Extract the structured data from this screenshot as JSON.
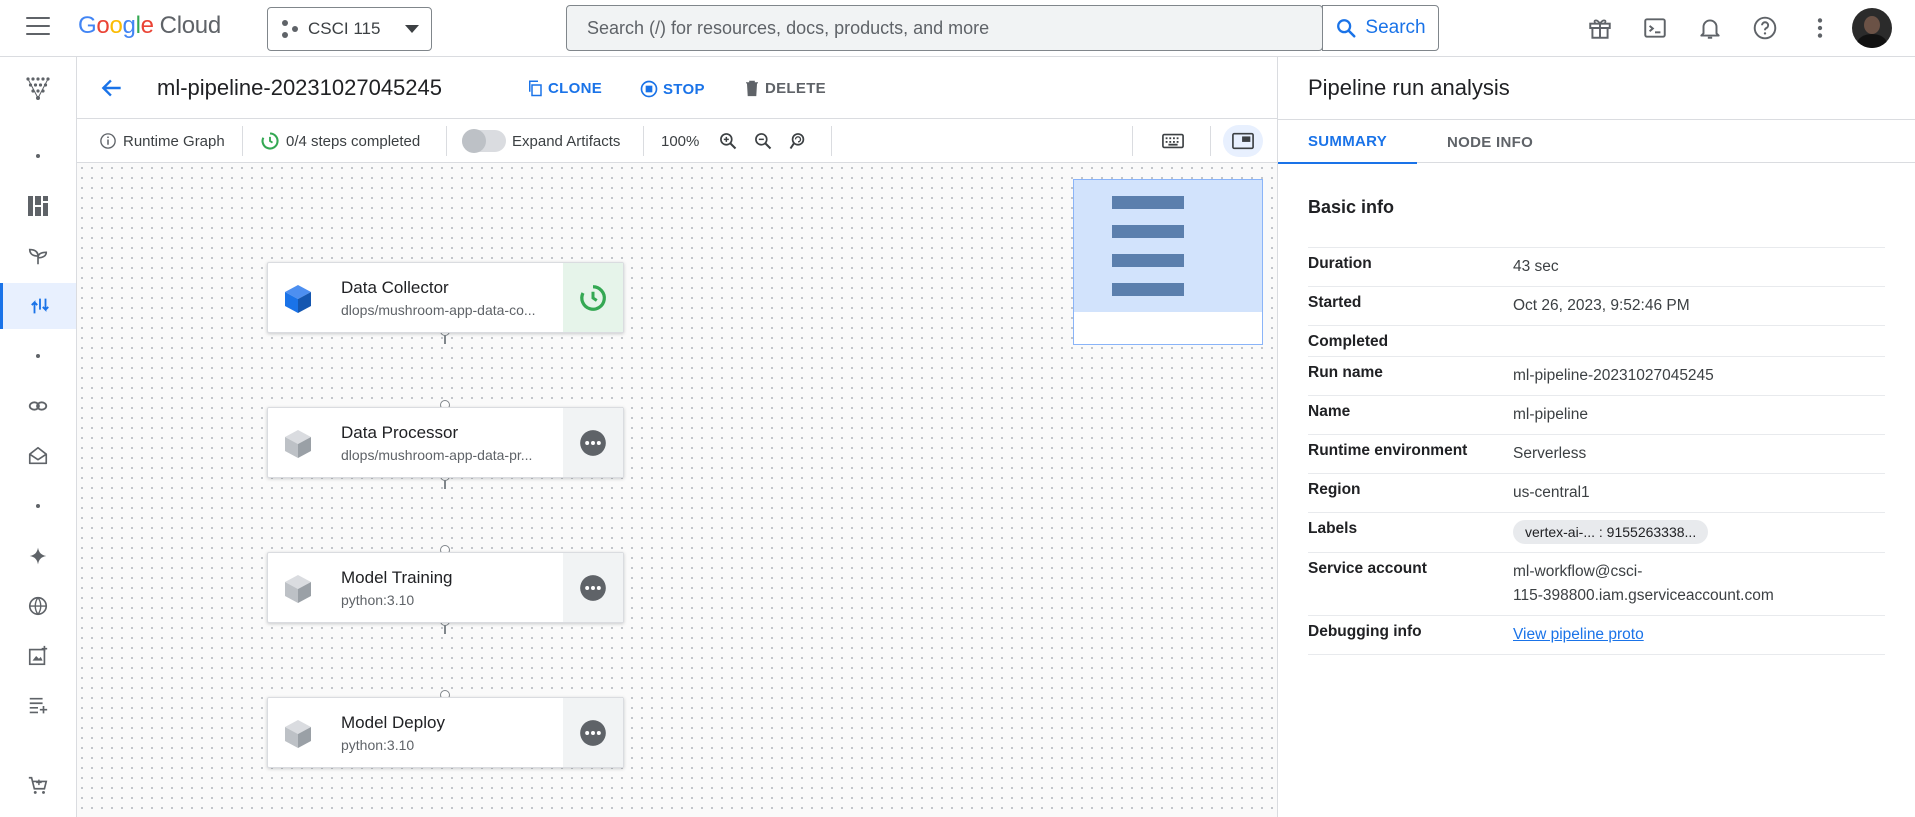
{
  "topbar": {
    "logo_google": [
      "G",
      "o",
      "o",
      "g",
      "l",
      "e"
    ],
    "logo_cloud": "Cloud",
    "project_name": "CSCI 115",
    "search_placeholder": "Search (/) for resources, docs, products, and more",
    "search_button": "Search",
    "icons": [
      "gift-icon",
      "terminal-icon",
      "bell-icon",
      "help-icon",
      "more-vert-icon"
    ]
  },
  "header": {
    "title": "ml-pipeline-20231027045245",
    "clone": "CLONE",
    "stop": "STOP",
    "delete": "DELETE",
    "accent": "#1a73e8"
  },
  "toolbar": {
    "runtime_graph": "Runtime Graph",
    "steps": "0/4 steps completed",
    "expand_artifacts": "Expand Artifacts",
    "zoom": "100%"
  },
  "nodes": [
    {
      "title": "Data Collector",
      "subtitle": "dlops/mushroom-app-data-co...",
      "status": "running",
      "active": true
    },
    {
      "title": "Data Processor",
      "subtitle": "dlops/mushroom-app-data-pr...",
      "status": "pending",
      "active": false
    },
    {
      "title": "Model Training",
      "subtitle": "python:3.10",
      "status": "pending",
      "active": false
    },
    {
      "title": "Model Deploy",
      "subtitle": "python:3.10",
      "status": "pending",
      "active": false
    }
  ],
  "panel": {
    "title": "Pipeline run analysis",
    "tabs": [
      "SUMMARY",
      "NODE INFO"
    ],
    "section": "Basic info",
    "rows": [
      {
        "key": "Duration",
        "value": "43 sec"
      },
      {
        "key": "Started",
        "value": "Oct 26, 2023, 9:52:46 PM"
      },
      {
        "key": "Completed",
        "value": ""
      },
      {
        "key": "Run name",
        "value": "ml-pipeline-20231027045245"
      },
      {
        "key": "Name",
        "value": "ml-pipeline"
      },
      {
        "key": "Runtime environment",
        "value": "Serverless"
      },
      {
        "key": "Region",
        "value": "us-central1"
      },
      {
        "key": "Labels",
        "chip": "vertex-ai-... : 9155263338..."
      },
      {
        "key": "Service account",
        "value_lines": [
          "ml-workflow@csci-",
          "115-398800.iam.gserviceaccount.com"
        ]
      },
      {
        "key": "Debugging info",
        "link": "View pipeline proto"
      }
    ]
  },
  "colors": {
    "success": "#34a853",
    "pending": "#5f6368",
    "cube_active": "#1a73e8",
    "cube_inactive": "#bdc1c6"
  }
}
